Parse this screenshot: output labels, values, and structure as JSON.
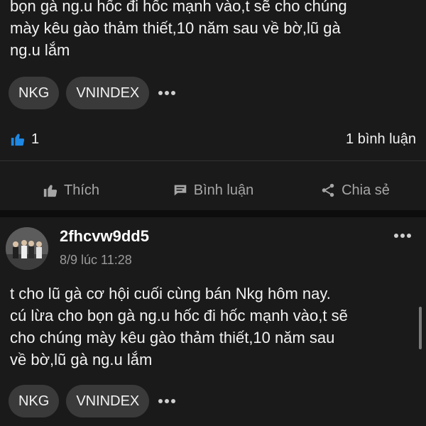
{
  "posts": [
    {
      "text_lines": [
        "bọn gà ng.u hốc đi hốc mạnh vào,t sẽ  cho chúng",
        "mày kêu gào thảm thiết,10 năm sau về bờ,lũ gà",
        "ng.u lắm"
      ],
      "tags": [
        "NKG",
        "VNINDEX"
      ],
      "like_count": "1",
      "comment_count": "1 bình luận"
    },
    {
      "username": "2fhcvw9dd5",
      "timestamp": "8/9 lúc 11:28",
      "text_lines": [
        "t cho lũ gà cơ hội cuối cùng bán Nkg hôm nay.",
        "cú lừa cho bọn gà ng.u hốc đi hốc mạnh vào,t sẽ",
        "cho chúng mày kêu gào thảm thiết,10 năm sau",
        "về bờ,lũ gà ng.u lắm"
      ],
      "tags": [
        "NKG",
        "VNINDEX"
      ]
    }
  ],
  "actions": {
    "like": "Thích",
    "comment": "Bình luận",
    "share": "Chia sẻ"
  },
  "colors": {
    "background": "#1a1a1a",
    "like_blue": "#1e88e5",
    "tag_bg": "#3a3a3a",
    "muted": "#a6a6a6"
  },
  "icons": {
    "like": "thumbs-up-icon",
    "comment": "comment-icon",
    "share": "share-icon",
    "more": "more-horizontal-icon"
  }
}
